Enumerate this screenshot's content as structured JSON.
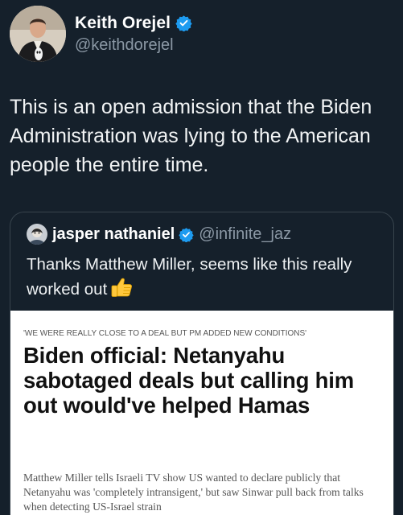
{
  "author": {
    "display_name": "Keith Orejel",
    "handle": "@keithdorejel",
    "verified": true,
    "avatar_icon": "profile-photo"
  },
  "tweet": {
    "text": "This is an open admission that the Biden Administration was lying to the American people the entire time."
  },
  "quoted": {
    "display_name": "jasper nathaniel",
    "handle": "@infinite_jaz",
    "verified": true,
    "text": "Thanks Matthew Miller, seems like this really worked out",
    "emoji_icon": "thumbs-up-icon",
    "article": {
      "kicker": "'WE WERE REALLY CLOSE TO A DEAL BUT PM ADDED NEW CONDITIONS'",
      "headline": "Biden official: Netanyahu sabotaged deals but calling him out would've helped Hamas",
      "summary": "Matthew Miller tells Israeli TV show US wanted to declare publicly that Netanyahu was 'completely intransigent,' but saw Sinwar pull back from talks when detecting US-Israel strain"
    }
  },
  "colors": {
    "background": "#15202b",
    "verified_blue": "#1d9bf0",
    "secondary_text": "#8b98a5",
    "border": "#38444d"
  }
}
